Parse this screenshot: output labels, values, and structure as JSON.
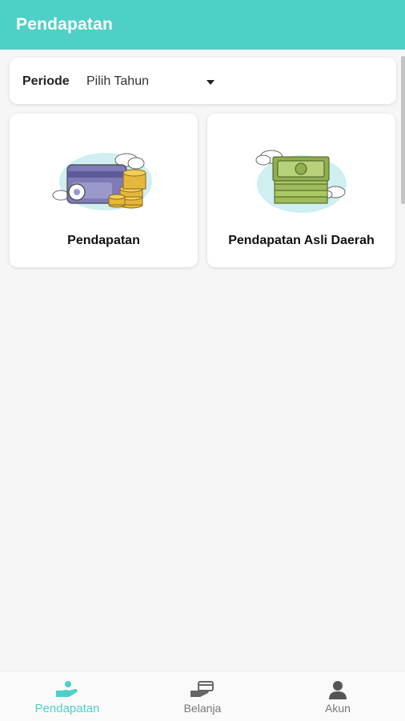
{
  "appbar": {
    "title": "Pendapatan"
  },
  "filter": {
    "label": "Periode",
    "select_value": "Pilih Tahun"
  },
  "cards": [
    {
      "label": "Pendapatan",
      "icon": "wallet-coins-icon"
    },
    {
      "label": "Pendapatan Asli Daerah",
      "icon": "cash-stack-icon"
    }
  ],
  "bottom_nav": {
    "items": [
      {
        "label": "Pendapatan",
        "icon": "hand-coin-icon",
        "active": true
      },
      {
        "label": "Belanja",
        "icon": "hand-card-icon",
        "active": false
      },
      {
        "label": "Akun",
        "icon": "user-icon",
        "active": false
      }
    ]
  },
  "colors": {
    "primary": "#4fd0c6",
    "background": "#f6f6f6",
    "card": "#ffffff",
    "inactive": "#777777"
  }
}
